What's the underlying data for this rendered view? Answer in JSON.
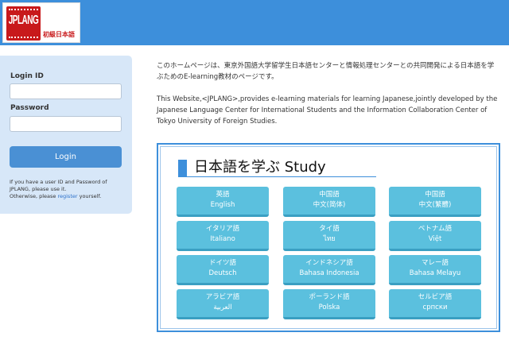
{
  "header": {
    "logo": {
      "mark_text": "JPLANG",
      "subtitle": "初級日本語"
    }
  },
  "login": {
    "login_id_label": "Login ID",
    "login_id_value": "",
    "password_label": "Password",
    "password_value": "",
    "button_label": "Login",
    "note_line1": "If you have a user ID and Password of JPLANG, please use it.",
    "note_line2_before": "Otherwise, please ",
    "note_link": "register",
    "note_line2_after": " yourself."
  },
  "intro": {
    "japanese": "このホームページは、東京外国語大学留学生日本語センターと情報処理センターとの共同開発による日本語を学ぶためのE-learning教材のページです。",
    "english": "This Website,<JPLANG>,provides e-learning materials for learning Japanese,jointly developed by the Japanese Language Center for International Students and the Information Collaboration Center of Tokyo University of Foreign Studies."
  },
  "study": {
    "title": "日本語を学ぶ Study",
    "accent_color": "#3d8fdb",
    "languages": [
      {
        "native": "英語",
        "name": "English"
      },
      {
        "native": "中国語",
        "name": "中文(简体)"
      },
      {
        "native": "中国語",
        "name": "中文(繁體)"
      },
      {
        "native": "イタリア語",
        "name": "Italiano"
      },
      {
        "native": "タイ語",
        "name": "ไทย"
      },
      {
        "native": "ベトナム語",
        "name": "Việt"
      },
      {
        "native": "ドイツ語",
        "name": "Deutsch"
      },
      {
        "native": "インドネシア語",
        "name": "Bahasa Indonesia"
      },
      {
        "native": "マレー語",
        "name": "Bahasa Melayu"
      },
      {
        "native": "アラビア語",
        "name": "العربية"
      },
      {
        "native": "ポーランド語",
        "name": "Polska"
      },
      {
        "native": "セルビア語",
        "name": "српски"
      }
    ]
  },
  "colors": {
    "header_bg": "#3d8fdb",
    "login_panel_bg": "#d7e7f8",
    "login_button": "#4a90d4",
    "language_button": "#5bc0de"
  }
}
